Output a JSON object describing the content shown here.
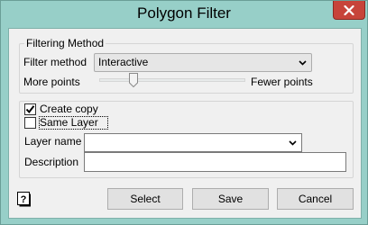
{
  "window": {
    "title": "Polygon Filter"
  },
  "filtering_group": {
    "legend": "Filtering Method",
    "filter_method_label": "Filter method",
    "filter_method_value": "Interactive",
    "slider_left_label": "More points",
    "slider_right_label": "Fewer points",
    "slider_level": 0.22
  },
  "options": {
    "create_copy_label": "Create copy",
    "create_copy_checked": true,
    "same_layer_label": "Same Layer",
    "same_layer_checked": false,
    "layer_name_label": "Layer name",
    "layer_name_value": "",
    "description_label": "Description",
    "description_value": ""
  },
  "buttons": {
    "select": "Select",
    "save": "Save",
    "cancel": "Cancel"
  },
  "icons": {
    "close": "close-icon",
    "help": "help-icon",
    "dropdown": "chevron-down-icon"
  },
  "colors": {
    "title_bar": "#97cfc8",
    "close_button": "#c7443a",
    "dialog_body": "#f0f0f0"
  }
}
